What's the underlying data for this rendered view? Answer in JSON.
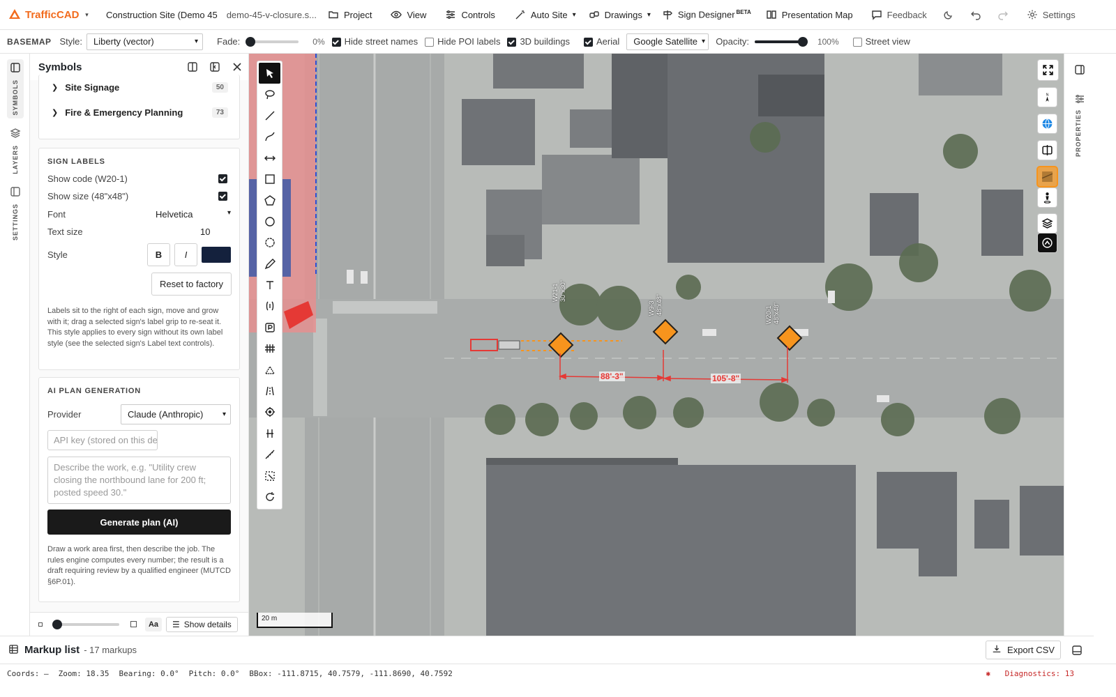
{
  "app": {
    "name": "TrafficCAD",
    "project_title": "Construction Site (Demo 45",
    "file_name": "demo-45-v-closure.s..."
  },
  "menu": {
    "project": "Project",
    "view": "View",
    "controls": "Controls",
    "auto_site": "Auto Site",
    "drawings": "Drawings",
    "sign_designer": "Sign Designer",
    "sign_designer_badge": "BETA",
    "presentation_map": "Presentation Map",
    "feedback": "Feedback",
    "settings": "Settings"
  },
  "basemap": {
    "section": "BASEMAP",
    "style_label": "Style:",
    "style_value": "Liberty (vector)",
    "fade_label": "Fade:",
    "fade_value": "0%",
    "fade_fraction": 0,
    "hide_street_names": {
      "label": "Hide street names",
      "checked": true
    },
    "hide_poi_labels": {
      "label": "Hide POI labels",
      "checked": false
    },
    "buildings_3d": {
      "label": "3D buildings",
      "checked": true
    },
    "aerial": {
      "label": "Aerial",
      "checked": true
    },
    "aerial_source": "Google Satellite",
    "opacity_label": "Opacity:",
    "opacity_value": "100%",
    "opacity_fraction": 1,
    "street_view": {
      "label": "Street view",
      "checked": false
    }
  },
  "rail": {
    "symbols": "SYMBOLS",
    "layers": "LAYERS",
    "settings": "SETTINGS",
    "properties": "PROPERTIES"
  },
  "panel": {
    "title": "Symbols",
    "categories": [
      {
        "name": "Site Signage",
        "count": "50"
      },
      {
        "name": "Fire & Emergency Planning",
        "count": "73"
      }
    ],
    "sign_labels": {
      "title": "SIGN LABELS",
      "show_code": {
        "label": "Show code (W20-1)",
        "checked": true
      },
      "show_size": {
        "label": "Show size (48\"x48\")",
        "checked": true
      },
      "font_label": "Font",
      "font_value": "Helvetica",
      "text_size_label": "Text size",
      "text_size_value": "10",
      "style_label": "Style",
      "bold": "B",
      "italic": "I",
      "color": "#14213d",
      "reset": "Reset to factory",
      "help": "Labels sit to the right of each sign, move and grow with it; drag a selected sign's label grip to re-seat it. This style applies to every sign without its own label style (see the selected sign's Label text controls)."
    },
    "ai": {
      "title": "AI PLAN GENERATION",
      "provider_label": "Provider",
      "provider_value": "Claude (Anthropic)",
      "api_key_placeholder": "API key (stored on this de",
      "describe_placeholder": "Describe the work, e.g. \"Utility crew closing the northbound lane for 200 ft; posted speed 30.\"",
      "generate": "Generate plan (AI)",
      "help": "Draw a work area first, then describe the job. The rules engine computes every number; the result is a draft requiring review by a qualified engineer (MUTCD §6P.01)."
    },
    "footer": {
      "aa": "Aa",
      "show_details": "Show details",
      "size_fraction": 0
    }
  },
  "map": {
    "scale": "20 m",
    "signs": [
      {
        "code": "W21-1",
        "size": "30\"x30\""
      },
      {
        "code": "W9-3",
        "size": "48\"x48\""
      },
      {
        "code": "W20-1",
        "size": "48\"x48\""
      }
    ],
    "dimensions": [
      "88'-3\"",
      "105'-8\""
    ]
  },
  "markup": {
    "title": "Markup list",
    "count": "- 17 markups",
    "export": "Export CSV"
  },
  "status": {
    "coords": "Coords: —",
    "zoom": "Zoom: 18.35",
    "bearing": "Bearing: 0.0°",
    "pitch": "Pitch: 0.0°",
    "bbox": "BBox: -111.8715, 40.7579, -111.8690, 40.7592",
    "diagnostics": "Diagnostics: 13"
  },
  "colors": {
    "brand": "#f26b1d",
    "dimension": "#e53935",
    "sign_fill": "#f7941d",
    "diagnostics": "#c62828"
  }
}
